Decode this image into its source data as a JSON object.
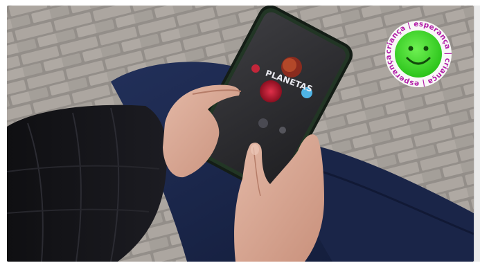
{
  "video": {
    "phone_app_title": "PLANETAS"
  },
  "logo": {
    "ring_text": "criança | esperança | criança | esperança | ",
    "colors": {
      "text": "#b21fa8",
      "face": "#3ddc2a",
      "ring_background": "#ffffff"
    }
  },
  "icons": {
    "logo": "smiley-face-icon"
  }
}
